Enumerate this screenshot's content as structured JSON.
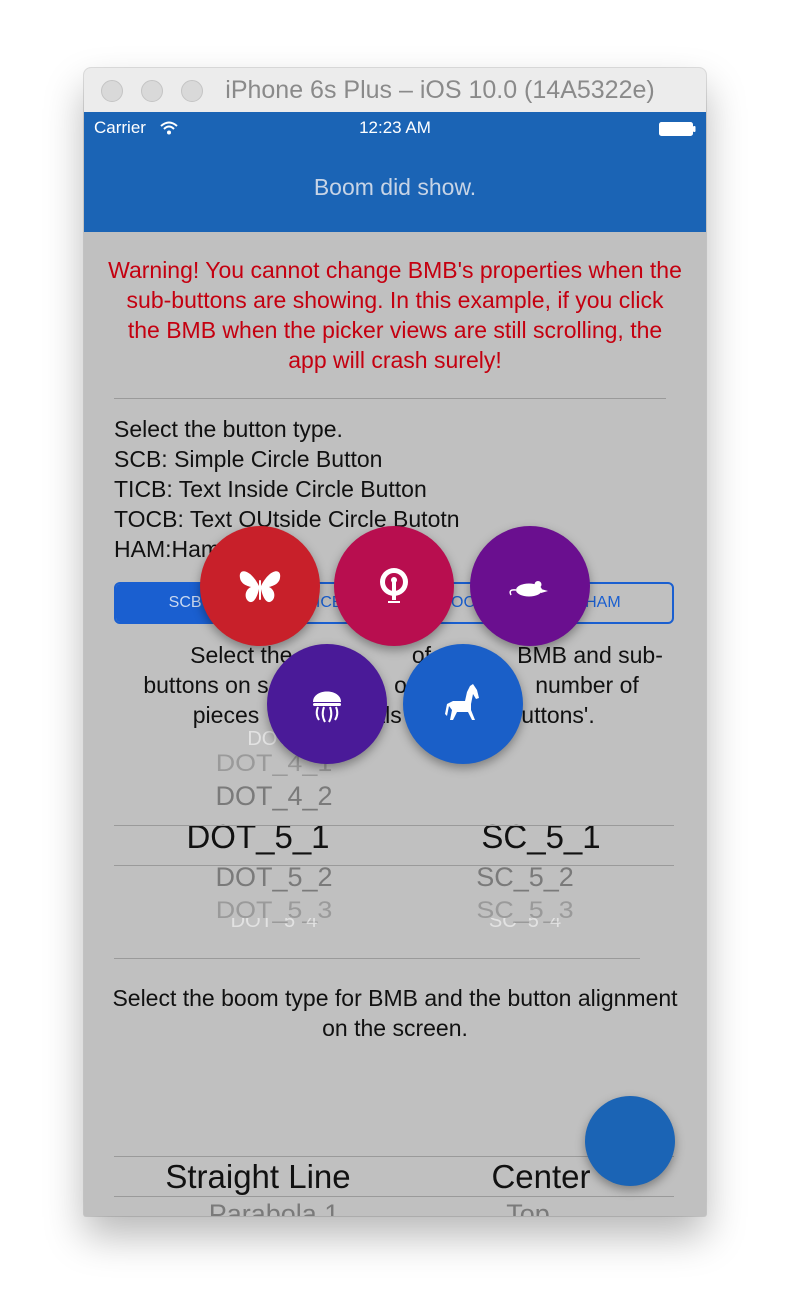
{
  "window": {
    "title": "iPhone 6s Plus – iOS 10.0 (14A5322e)"
  },
  "status_bar": {
    "carrier": "Carrier",
    "time": "12:23 AM"
  },
  "nav": {
    "title": "Boom did show."
  },
  "warning": "Warning! You cannot change BMB's properties when the sub-buttons are showing. In this example, if you click the BMB when the picker views are still scrolling, the app will crash surely!",
  "button_type": {
    "lines": [
      "Select the button type.",
      "SCB: Simple Circle Button",
      "TICB: Text Inside Circle Button",
      "TOCB: Text OUtside Circle Butotn",
      "HAM:Ham"
    ],
    "segments": [
      "SCB",
      "TICB",
      "TOCB",
      "HAM"
    ],
    "selected_index": 0
  },
  "piece_text": [
    "Select the place",
    "of pie",
    "BMB and sub-",
    "buttons on s",
    "optio",
    "number of",
    "pieces",
    "als",
    "uttons'."
  ],
  "piece_picker": {
    "left": [
      "DOT_",
      "DOT_4_1",
      "DOT_4_2",
      "DOT_5_1",
      "DOT_5_2",
      "DOT_5_3",
      "DOT_5_4"
    ],
    "right": [
      "SC_5_1",
      "SC_5_2",
      "SC_5_3",
      "SC_5_4"
    ]
  },
  "boom_text": "Select the boom type for BMB and the button alignment on the screen.",
  "boom_picker": {
    "left": [
      "Straight Line",
      "Parabola 1"
    ],
    "right": [
      "Center",
      "Top"
    ]
  },
  "sub_buttons": [
    {
      "icon": "butterfly-icon",
      "color": "#c8202a"
    },
    {
      "icon": "peacock-icon",
      "color": "#b80e4f"
    },
    {
      "icon": "mouse-icon",
      "color": "#6a0f8f"
    },
    {
      "icon": "jellyfish-icon",
      "color": "#4a1a98"
    },
    {
      "icon": "horse-icon",
      "color": "#1a5fc8"
    }
  ],
  "colors": {
    "nav": "#1b64b5",
    "warning": "#c40010",
    "background": "#c0c0c0",
    "segment_accent": "#1a5fd0"
  }
}
